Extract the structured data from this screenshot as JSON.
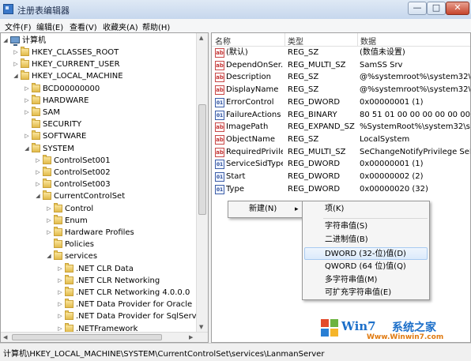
{
  "window": {
    "title": "注册表编辑器",
    "controls": {
      "minimize": "—",
      "maximize": "□",
      "close": "✕"
    }
  },
  "menubar": [
    "文件(F)",
    "编辑(E)",
    "查看(V)",
    "收藏夹(A)",
    "帮助(H)"
  ],
  "tree": {
    "root": "计算机",
    "items": [
      {
        "label": "HKEY_CLASSES_ROOT",
        "level": 1,
        "state": "collapsed"
      },
      {
        "label": "HKEY_CURRENT_USER",
        "level": 1,
        "state": "collapsed"
      },
      {
        "label": "HKEY_LOCAL_MACHINE",
        "level": 1,
        "state": "expanded"
      },
      {
        "label": "BCD00000000",
        "level": 2,
        "state": "collapsed"
      },
      {
        "label": "HARDWARE",
        "level": 2,
        "state": "collapsed"
      },
      {
        "label": "SAM",
        "level": 2,
        "state": "collapsed"
      },
      {
        "label": "SECURITY",
        "level": 2,
        "state": "none"
      },
      {
        "label": "SOFTWARE",
        "level": 2,
        "state": "collapsed"
      },
      {
        "label": "SYSTEM",
        "level": 2,
        "state": "expanded"
      },
      {
        "label": "ControlSet001",
        "level": 3,
        "state": "collapsed"
      },
      {
        "label": "ControlSet002",
        "level": 3,
        "state": "collapsed"
      },
      {
        "label": "ControlSet003",
        "level": 3,
        "state": "collapsed"
      },
      {
        "label": "CurrentControlSet",
        "level": 3,
        "state": "expanded"
      },
      {
        "label": "Control",
        "level": 4,
        "state": "collapsed"
      },
      {
        "label": "Enum",
        "level": 4,
        "state": "collapsed"
      },
      {
        "label": "Hardware Profiles",
        "level": 4,
        "state": "collapsed"
      },
      {
        "label": "Policies",
        "level": 4,
        "state": "none"
      },
      {
        "label": "services",
        "level": 4,
        "state": "expanded"
      },
      {
        "label": ".NET CLR Data",
        "level": 5,
        "state": "collapsed"
      },
      {
        "label": ".NET CLR Networking",
        "level": 5,
        "state": "collapsed"
      },
      {
        "label": ".NET CLR Networking 4.0.0.0",
        "level": 5,
        "state": "collapsed"
      },
      {
        "label": ".NET Data Provider for Oracle",
        "level": 5,
        "state": "collapsed"
      },
      {
        "label": ".NET Data Provider for SqlServe",
        "level": 5,
        "state": "collapsed"
      },
      {
        "label": ".NETFramework",
        "level": 5,
        "state": "collapsed"
      }
    ]
  },
  "list": {
    "columns": [
      "名称",
      "类型",
      "数据"
    ],
    "rows": [
      {
        "icon": "string-value-icon",
        "name": "(默认)",
        "type": "REG_SZ",
        "data": "(数值未设置)"
      },
      {
        "icon": "string-value-icon",
        "name": "DependOnSer...",
        "type": "REG_MULTI_SZ",
        "data": "SamSS Srv"
      },
      {
        "icon": "string-value-icon",
        "name": "Description",
        "type": "REG_SZ",
        "data": "@%systemroot%\\system32\\srv"
      },
      {
        "icon": "string-value-icon",
        "name": "DisplayName",
        "type": "REG_SZ",
        "data": "@%systemroot%\\system32\\srv"
      },
      {
        "icon": "binary-value-icon",
        "name": "ErrorControl",
        "type": "REG_DWORD",
        "data": "0x00000001 (1)"
      },
      {
        "icon": "binary-value-icon",
        "name": "FailureActions",
        "type": "REG_BINARY",
        "data": "80 51 01 00 00 00 00 00 00"
      },
      {
        "icon": "string-value-icon",
        "name": "ImagePath",
        "type": "REG_EXPAND_SZ",
        "data": "%SystemRoot%\\system32\\svch"
      },
      {
        "icon": "string-value-icon",
        "name": "ObjectName",
        "type": "REG_SZ",
        "data": "LocalSystem"
      },
      {
        "icon": "string-value-icon",
        "name": "RequiredPrivile...",
        "type": "REG_MULTI_SZ",
        "data": "SeChangeNotifyPrivilege SeImp"
      },
      {
        "icon": "binary-value-icon",
        "name": "ServiceSidType",
        "type": "REG_DWORD",
        "data": "0x00000001 (1)"
      },
      {
        "icon": "binary-value-icon",
        "name": "Start",
        "type": "REG_DWORD",
        "data": "0x00000002 (2)"
      },
      {
        "icon": "binary-value-icon",
        "name": "Type",
        "type": "REG_DWORD",
        "data": "0x00000020 (32)"
      }
    ]
  },
  "context_menu": {
    "new_label": "新建(N)",
    "arrow": "▸"
  },
  "submenu": {
    "items": [
      "项(K)",
      "字符串值(S)",
      "二进制值(B)",
      "DWORD (32-位)值(D)",
      "QWORD (64 位)值(Q)",
      "多字符串值(M)",
      "可扩充字符串值(E)"
    ],
    "highlighted": "DWORD (32-位)值(D)"
  },
  "statusbar": {
    "path": "计算机\\HKEY_LOCAL_MACHINE\\SYSTEM\\CurrentControlSet\\services\\LanmanServer"
  },
  "watermark": {
    "brand": "Win7",
    "cn": "系统之家",
    "url": "Www.Winwin7.com"
  },
  "colors": {
    "highlight": "#dbeafb",
    "watermark_blue": "#1c6fc9",
    "watermark_orange": "#e07a10"
  }
}
